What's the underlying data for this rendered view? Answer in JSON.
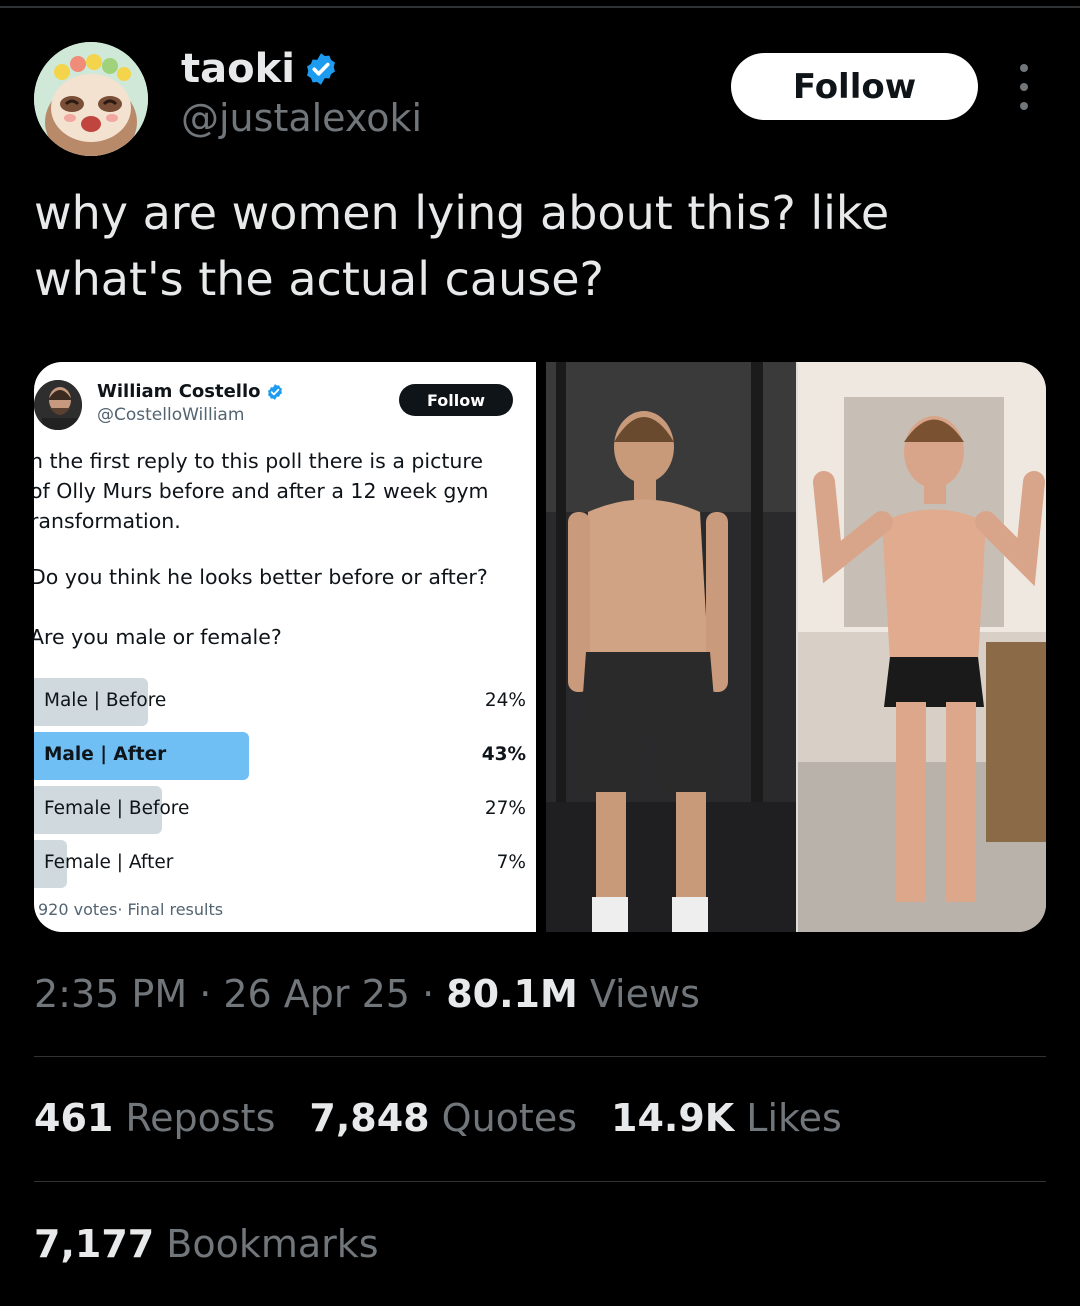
{
  "author": {
    "display_name": "taoki",
    "handle": "@justalexoki",
    "follow_label": "Follow"
  },
  "tweet": {
    "text": "why are women lying about this? like what's the actual cause?"
  },
  "quoted_poll": {
    "author_name": "William Costello",
    "author_handle": "@CostelloWilliam",
    "follow_label": "Follow",
    "text": "n the first reply to this poll there is a picture\nof Olly Murs before and after a 12 week gym\nransformation.",
    "question1": "Do you think he looks better before or after?",
    "question2": "Are you male or female?",
    "options": [
      {
        "label": "Male | Before",
        "percent": "24%",
        "share": 24
      },
      {
        "label": "Male | After",
        "percent": "43%",
        "share": 43
      },
      {
        "label": "Female | Before",
        "percent": "27%",
        "share": 27
      },
      {
        "label": "Female | After",
        "percent": "7%",
        "share": 7
      }
    ],
    "votes": "920 votes· Final results"
  },
  "meta": {
    "time": "2:35 PM",
    "sep1": " · ",
    "date": "26 Apr 25",
    "sep2": " · ",
    "views_count": "80.1M",
    "views_label": " Views"
  },
  "stats": {
    "reposts_count": "461",
    "reposts_label": "Reposts",
    "quotes_count": "7,848",
    "quotes_label": "Quotes",
    "likes_count": "14.9K",
    "likes_label": "Likes",
    "bookmarks_count": "7,177",
    "bookmarks_label": "Bookmarks"
  },
  "colors": {
    "background": "#000000",
    "accent_blue": "#1d9bf0",
    "poll_winner": "#6fbff5",
    "poll_bar": "#cfd9de",
    "muted_text": "#71767b"
  }
}
